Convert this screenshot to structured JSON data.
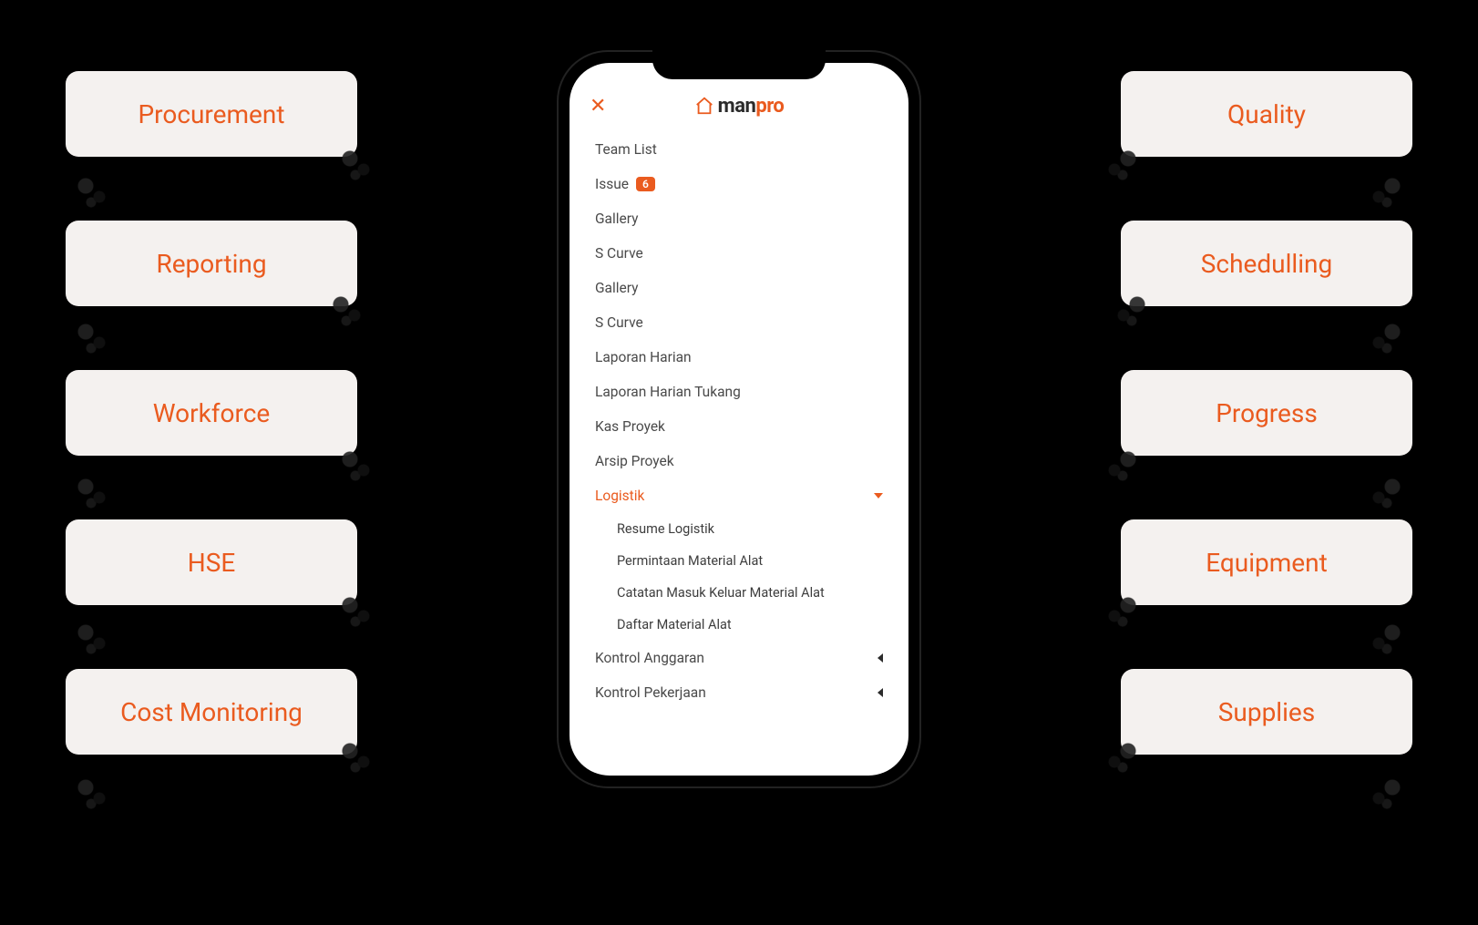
{
  "features_left": [
    "Procurement",
    "Reporting",
    "Workforce",
    "HSE",
    "Cost Monitoring"
  ],
  "features_right": [
    "Quality",
    "Schedulling",
    "Progress",
    "Equipment",
    "Supplies"
  ],
  "app": {
    "logo_text1": "man",
    "logo_text2": "pro"
  },
  "menu": {
    "items": [
      {
        "label": "Team List"
      },
      {
        "label": "Issue",
        "badge": "6"
      },
      {
        "label": "Gallery"
      },
      {
        "label": "S Curve"
      },
      {
        "label": "Gallery"
      },
      {
        "label": "S Curve"
      },
      {
        "label": "Laporan Harian"
      },
      {
        "label": "Laporan Harian Tukang"
      },
      {
        "label": "Kas Proyek"
      },
      {
        "label": "Arsip Proyek"
      }
    ],
    "logistik": {
      "label": "Logistik",
      "children": [
        "Resume Logistik",
        "Permintaan Material Alat",
        "Catatan Masuk Keluar Material Alat",
        "Daftar Material Alat"
      ]
    },
    "bottom": [
      {
        "label": "Kontrol Anggaran"
      },
      {
        "label": "Kontrol Pekerjaan"
      }
    ]
  }
}
